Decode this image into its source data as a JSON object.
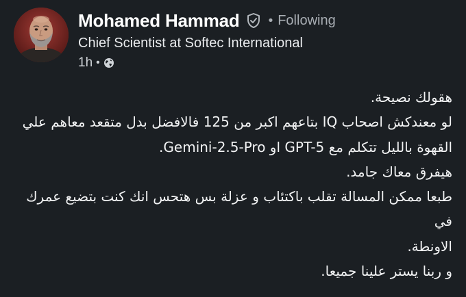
{
  "author": {
    "name": "Mohamed Hammad",
    "follow_status": "Following",
    "separator": "•",
    "headline": "Chief Scientist at Softec International",
    "time": "1h",
    "time_separator": "•"
  },
  "icons": {
    "verified": "verified-shield-icon",
    "visibility": "globe-icon"
  },
  "colors": {
    "background": "#1b1f23",
    "text_primary": "#ffffff",
    "text_secondary": "#a8adb3"
  },
  "post": {
    "lines": [
      "هقولك نصيحة.",
      "لو معندكش اصحاب IQ بتاعهم اكبر من 125 فالافضل بدل متقعد معاهم علي",
      "القهوة بالليل تتكلم مع GPT-5 او Gemini-2.5-Pro.",
      "هيفرق معاك جامد.",
      "طبعا ممكن المسالة تقلب باكتئاب و عزلة بس هتحس انك كنت بتضيع عمرك في",
      "الاونطة.",
      "و ربنا يستر علينا جميعا."
    ]
  }
}
